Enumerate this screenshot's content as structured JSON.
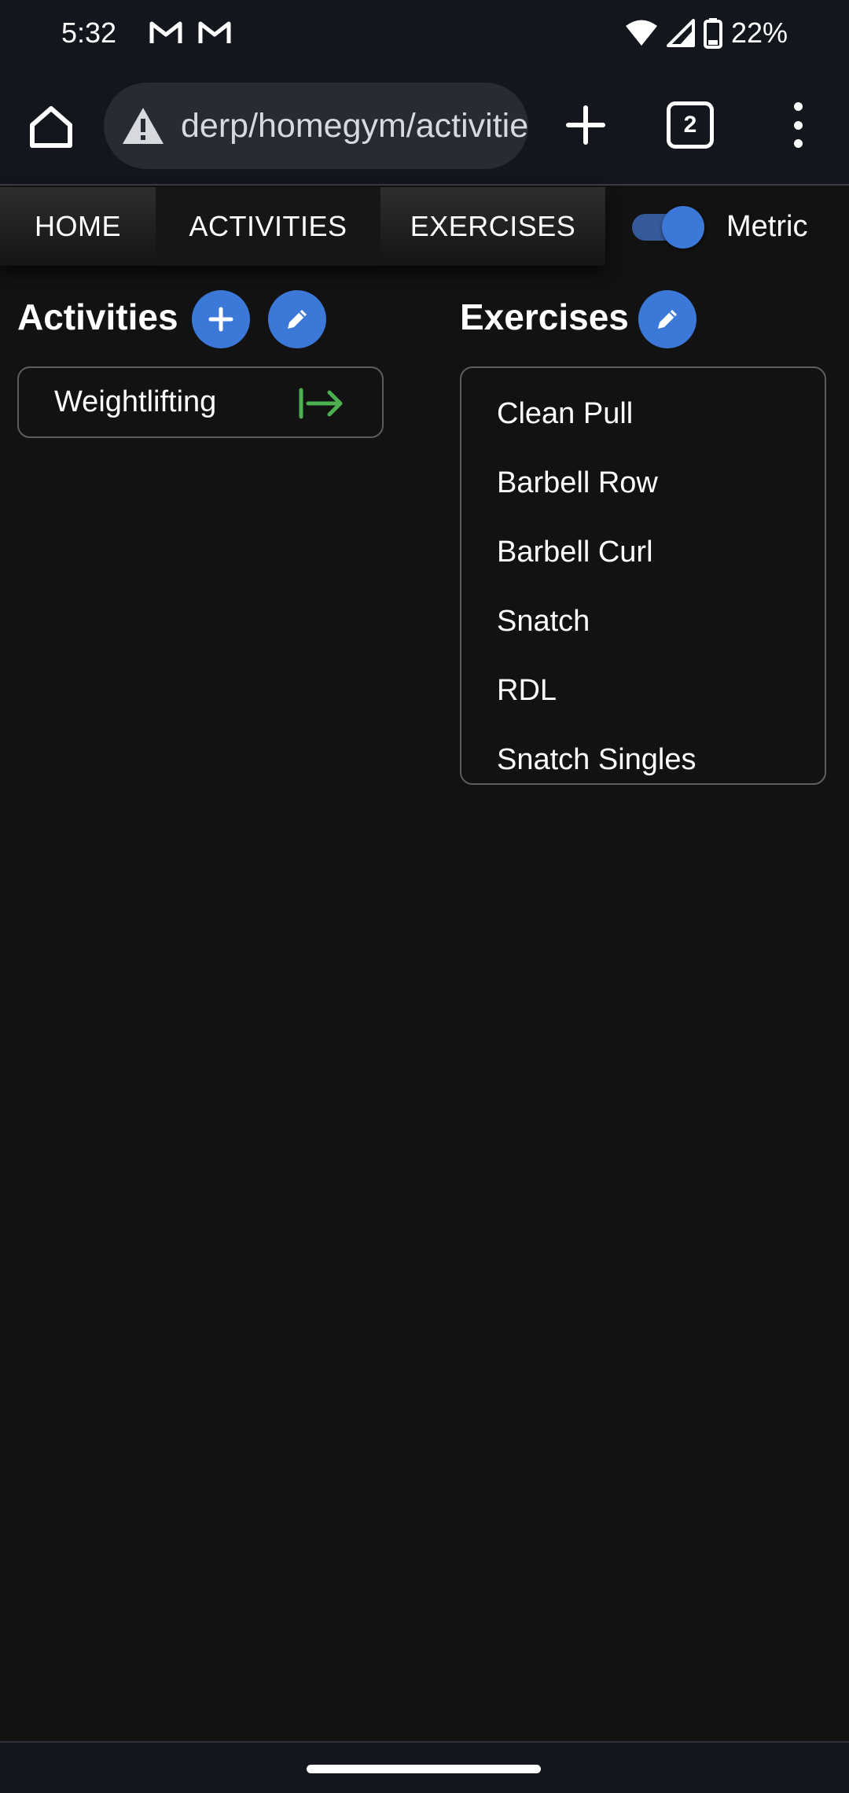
{
  "status_bar": {
    "time": "5:32",
    "notification_icons": [
      "gmail-icon",
      "gmail-icon"
    ],
    "battery_percent": "22%"
  },
  "browser": {
    "url": "derp/homegym/activities",
    "security_icon": "warning-icon",
    "tab_count": "2"
  },
  "nav": {
    "tabs": [
      {
        "label": "HOME"
      },
      {
        "label": "ACTIVITIES"
      },
      {
        "label": "EXERCISES"
      }
    ],
    "active_tab": "ACTIVITIES",
    "metric_label": "Metric",
    "metric_enabled": true
  },
  "activities": {
    "title": "Activities",
    "items": [
      {
        "label": "Weightlifting"
      }
    ]
  },
  "exercises": {
    "title": "Exercises",
    "items": [
      {
        "label": "Clean Pull"
      },
      {
        "label": "Barbell Row"
      },
      {
        "label": "Barbell Curl"
      },
      {
        "label": "Snatch"
      },
      {
        "label": "RDL"
      },
      {
        "label": "Snatch Singles"
      }
    ]
  },
  "colors": {
    "accent": "#3b78d8",
    "go_arrow": "#4caf50",
    "background": "#121212"
  }
}
